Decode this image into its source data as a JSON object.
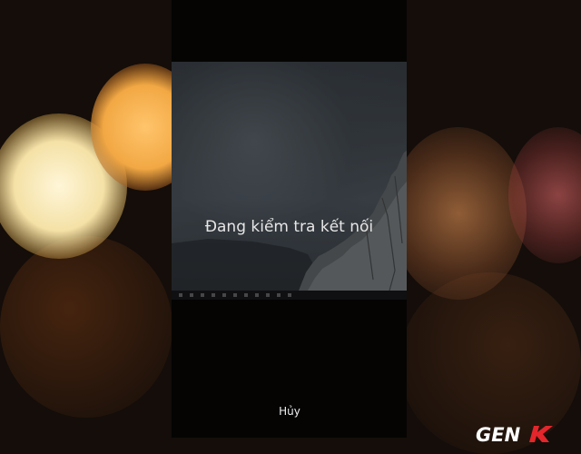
{
  "connection_screen": {
    "status_text": "Đang kiểm tra kết nối",
    "cancel_label": "Hủy"
  },
  "watermark": {
    "text": "GENK"
  },
  "colors": {
    "bokeh_orange": "#f2a844",
    "bokeh_cream": "#f4e1a6",
    "watermark_accent": "#e3262b"
  }
}
